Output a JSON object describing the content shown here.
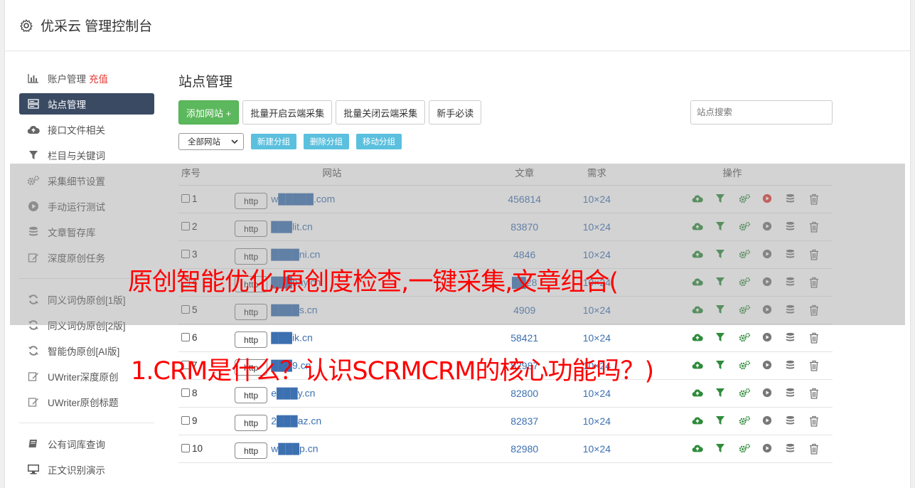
{
  "app": {
    "title": "优采云 管理控制台"
  },
  "sidebar": {
    "items": [
      {
        "label": "账户管理",
        "badge": "充值",
        "icon": "bar-chart-icon"
      },
      {
        "label": "站点管理",
        "icon": "server-icon",
        "active": true
      },
      {
        "label": "接口文件相关",
        "icon": "cloud-upload-icon"
      },
      {
        "label": "栏目与关键词",
        "icon": "filter-icon"
      },
      {
        "label": "采集细节设置",
        "icon": "cogs-icon"
      },
      {
        "label": "手动运行测试",
        "icon": "play-circle-icon"
      },
      {
        "label": "文章暂存库",
        "icon": "database-icon"
      },
      {
        "label": "深度原创任务",
        "icon": "edit-icon"
      },
      {
        "label": "同义词伪原创[1版]",
        "icon": "refresh-icon"
      },
      {
        "label": "同义词伪原创[2版]",
        "icon": "refresh-icon"
      },
      {
        "label": "智能伪原创[AI版]",
        "icon": "refresh-icon"
      },
      {
        "label": "UWriter深度原创",
        "icon": "edit-icon"
      },
      {
        "label": "UWriter原创标题",
        "icon": "edit-icon"
      },
      {
        "label": "公有词库查询",
        "icon": "book-icon"
      },
      {
        "label": "正文识别演示",
        "icon": "monitor-icon"
      }
    ]
  },
  "main": {
    "title": "站点管理",
    "toolbar": {
      "add_site": "添加网站 +",
      "batch_open": "批量开启云端采集",
      "batch_close": "批量关闭云端采集",
      "guide": "新手必读",
      "search_placeholder": "站点搜索"
    },
    "group_select": "全部网站",
    "group_buttons": {
      "new": "新建分组",
      "delete": "删除分组",
      "move": "移动分组"
    },
    "table": {
      "headers": {
        "no": "序号",
        "site": "网站",
        "articles": "文章",
        "demand": "需求",
        "ops": "操作"
      },
      "rows": [
        {
          "no": "1",
          "http": "http",
          "domain": "w█████.com",
          "articles": "456814",
          "demand": "10×24",
          "run_active": true
        },
        {
          "no": "2",
          "http": "http",
          "domain": "███lit.cn",
          "articles": "83870",
          "demand": "10×24",
          "run_active": false
        },
        {
          "no": "3",
          "http": "http",
          "domain": "████ni.cn",
          "articles": "4846",
          "demand": "10×24",
          "run_active": false
        },
        {
          "no": "4",
          "http": "http",
          "domain": "███bay.cn",
          "articles": "██28",
          "demand": "10×24",
          "run_active": false
        },
        {
          "no": "5",
          "http": "http",
          "domain": "████s.cn",
          "articles": "4909",
          "demand": "10×24",
          "run_active": false
        },
        {
          "no": "6",
          "http": "http",
          "domain": "███ik.cn",
          "articles": "58421",
          "demand": "10×24",
          "run_active": false
        },
        {
          "no": "7",
          "http": "http",
          "domain": "███9.cn",
          "articles": "82987",
          "demand": "10×24",
          "run_active": false
        },
        {
          "no": "8",
          "http": "http",
          "domain": "e███y.cn",
          "articles": "82800",
          "demand": "10×24",
          "run_active": false
        },
        {
          "no": "9",
          "http": "http",
          "domain": "2███az.cn",
          "articles": "82837",
          "demand": "10×24",
          "run_active": false
        },
        {
          "no": "10",
          "http": "http",
          "domain": "w███p.cn",
          "articles": "82980",
          "demand": "10×24",
          "run_active": false
        }
      ]
    }
  },
  "overlay_caption": {
    "line1": "原创智能优化,原创度检查,一键采集,文章组合(",
    "line2": "1.CRM是什么？认识SCRMCRM的核心功能吗？)"
  },
  "colors": {
    "sidebar_active": "#3a4a63",
    "primary_green": "#5cb85c",
    "info_blue": "#5bc0de",
    "link_blue": "#3c70b0",
    "caption_red": "#ff0000"
  }
}
